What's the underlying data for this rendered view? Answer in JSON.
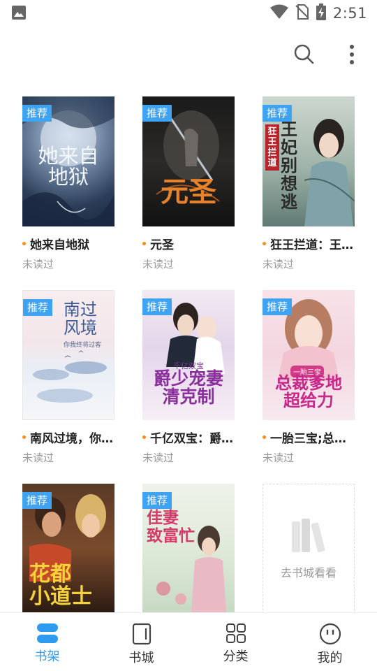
{
  "status_bar": {
    "time": "2:51"
  },
  "shelf": {
    "books": [
      {
        "title": "她来自地狱",
        "status": "未读过",
        "tag": "推荐",
        "cover_text": "她来自地狱",
        "cover_line1": "她来自",
        "cover_line2": "地狱"
      },
      {
        "title": "元圣",
        "status": "未读过",
        "tag": "推荐",
        "cover_text": "元圣"
      },
      {
        "title": "狂王拦道：王妃别想逃",
        "status": "未读过",
        "tag": "推荐",
        "cover_text": "王妃别想逃",
        "cover_sub": "狂王拦道"
      },
      {
        "title": "南风过境，你我终将成为过客",
        "status": "未读过",
        "tag": "推荐",
        "cover_text": "南过风境",
        "cover_sub": "你我终将过客"
      },
      {
        "title": "千亿双宝：爵少宠妻",
        "status": "未读过",
        "tag": "推荐",
        "cover_text": "爵少宠妻",
        "cover_line2": "清克制",
        "cover_sub": "千亿双宝"
      },
      {
        "title": "一胎三宝;总裁爹地超给力",
        "status": "未读过",
        "tag": "推荐",
        "cover_text": "总裁爹地",
        "cover_line2": "超给力",
        "cover_sub": "一胎三宝"
      },
      {
        "title": "花都小道士",
        "status": "",
        "tag": "推荐",
        "cover_text": "花都",
        "cover_line2": "小道士"
      },
      {
        "title": "佳妻致富忙",
        "status": "",
        "tag": "推荐",
        "cover_text": "佳妻",
        "cover_line2": "致富忙"
      }
    ],
    "store_card": {
      "label": "去书城看看",
      "icon": "books-icon"
    }
  },
  "bottom_nav": {
    "items": [
      {
        "label": "书架",
        "icon": "bookshelf-icon",
        "active": true
      },
      {
        "label": "书城",
        "icon": "book-store-icon",
        "active": false
      },
      {
        "label": "分类",
        "icon": "grid-icon",
        "active": false
      },
      {
        "label": "我的",
        "icon": "smiley-icon",
        "active": false
      }
    ]
  },
  "colors": {
    "accent": "#2f9bf0",
    "tag": "#3ea3f3",
    "dot": "#ff8a1f",
    "muted": "#9a9a9a"
  }
}
